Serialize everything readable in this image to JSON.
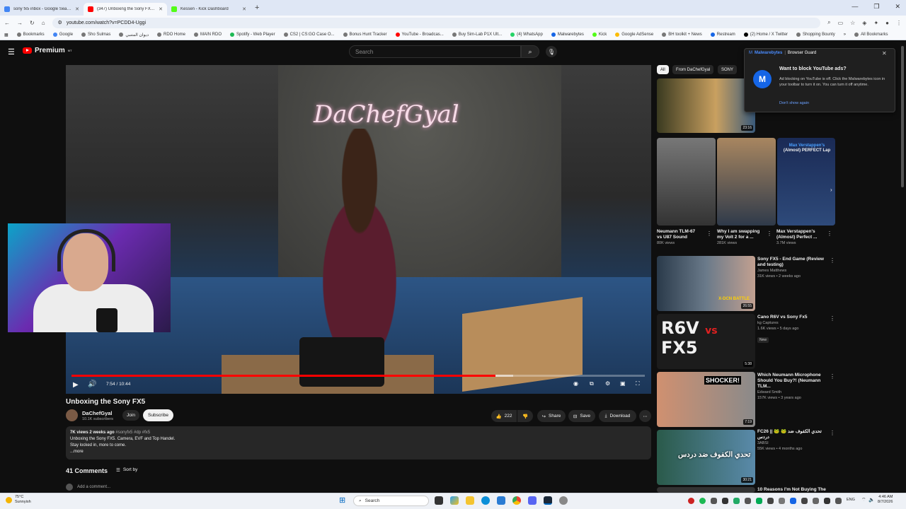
{
  "browser": {
    "tabs": [
      {
        "title": "sony fx5 inbox - Google Search",
        "color": "#4285f4",
        "active": false
      },
      {
        "title": "(347) Unboxing the Sony FX5 -",
        "color": "#ff0000",
        "active": true
      },
      {
        "title": "Kessen - Kick Dashboard",
        "color": "#53fc18",
        "active": false
      }
    ],
    "new_tab": "+",
    "window_controls": [
      "—",
      "❐",
      "✕"
    ],
    "url": "youtube.com/watch?v=PCDD4-Uggi",
    "bookmarks": [
      "Bookmarks",
      "Google",
      "Sho Sulmas",
      "دیوان المتنبي",
      "RDO Home",
      "MAIN RDO",
      "Spotify - Web Player",
      "CS2 | CS:GO Case O...",
      "Bonus Hunt Tracker",
      "YouTube - Broadcas...",
      "Buy Sim-Lab P1X Ult...",
      "(4) WhatsApp",
      "Malwarebytes",
      "Kick",
      "Google AdSense",
      "BH toolkit + News",
      "Restream",
      "(2) Home / X Twitter",
      "Shopping Bounty"
    ],
    "all_bookmarks": "All Bookmarks"
  },
  "youtube": {
    "logo": "Premium",
    "logo_sup": "MT",
    "search_placeholder": "Search",
    "video": {
      "current_time": "7:54",
      "duration": "10:44",
      "time_display": "7:54 / 10:44",
      "progress": 0.74,
      "buffered": 0.77,
      "neon_sign": "DaChefGyal"
    },
    "title": "Unboxing the Sony FX5",
    "channel": {
      "name": "DaChefGyal",
      "subscribers": "10.1K subscribers",
      "join": "Join",
      "subscribe": "Subscribe"
    },
    "actions": {
      "likes": "222",
      "share": "Share",
      "save": "Save",
      "download": "Download"
    },
    "description": {
      "meta": "7K views  2 weeks ago",
      "tags": "#sonyfx5 #dp #fx5",
      "line1": "Unboxing the Sony FX5. Camera, EVF and Top Handel.",
      "line2": "Stay locked in, more to come.",
      "more": "...more"
    },
    "comments": {
      "count": "41 Comments",
      "sort": "Sort by",
      "add": "Add a comment..."
    },
    "chips": [
      "All",
      "From DaChefGyal",
      "SONY"
    ],
    "shorts": [
      {
        "title1": "Neumann TLM-67",
        "title2": "vs U87 Sound",
        "views": "80K views"
      },
      {
        "title1": "Why I am swapping",
        "title2": "my Volt 2 for a ...",
        "views": "281K views"
      },
      {
        "title1": "Max Verstappen's",
        "title2": "(Almost) Perfect ...",
        "views": "3.7M views",
        "overlay1": "Max Verstappen's",
        "overlay2": "(Almost) PERFECT Lap"
      }
    ],
    "recommended": [
      {
        "title": "",
        "channel": "",
        "meta": "",
        "duration": "23:16"
      },
      {
        "title": "Sony FX5 - End Game (Review and testing)",
        "channel": "James Matthews",
        "meta": "31K views • 2 weeks ago",
        "duration": "26:55",
        "thumb_text": "X-DCN BATTLE"
      },
      {
        "title": "Cano R6V vs Sony Fx5",
        "channel": "kg Captures",
        "meta": "1.6K views • 5 days ago",
        "badge": "New",
        "duration": "5:38",
        "thumb_text1": "R6V",
        "thumb_text2": "vs",
        "thumb_text3": "FX5"
      },
      {
        "title": "Which Neumann Microphone Should You Buy?! (Neumann TLM...",
        "channel": "Edward Smith",
        "meta": "157K views • 3 years ago",
        "duration": "7:19",
        "thumb_text": "SHOCKER!"
      },
      {
        "title": "FC26 || 🐸 🐸 تحدي الكفوف ضد دردس",
        "channel": "3ABSI",
        "meta": "55K views • 4 months ago",
        "duration": "30:21",
        "thumb_text": "تحدي الكفوف ضد دردس"
      },
      {
        "title": "10 Reasons I'm Not Buying The",
        "channel": "",
        "meta": "",
        "duration": ""
      }
    ]
  },
  "malwarebytes": {
    "brand": "Malwarebytes",
    "product": "Browser Guard",
    "question": "Want to block YouTube ads?",
    "text": "Ad blocking on YouTube is off. Click the Malwarebytes icon in your toolbar to turn it on. You can turn it off anytime.",
    "link": "Don't show again"
  },
  "taskbar": {
    "temp": "75°C",
    "weather": "Sunnyish",
    "search": "Search",
    "lang": "ENG",
    "time": "4:46 AM",
    "date": "8/7/2026"
  }
}
